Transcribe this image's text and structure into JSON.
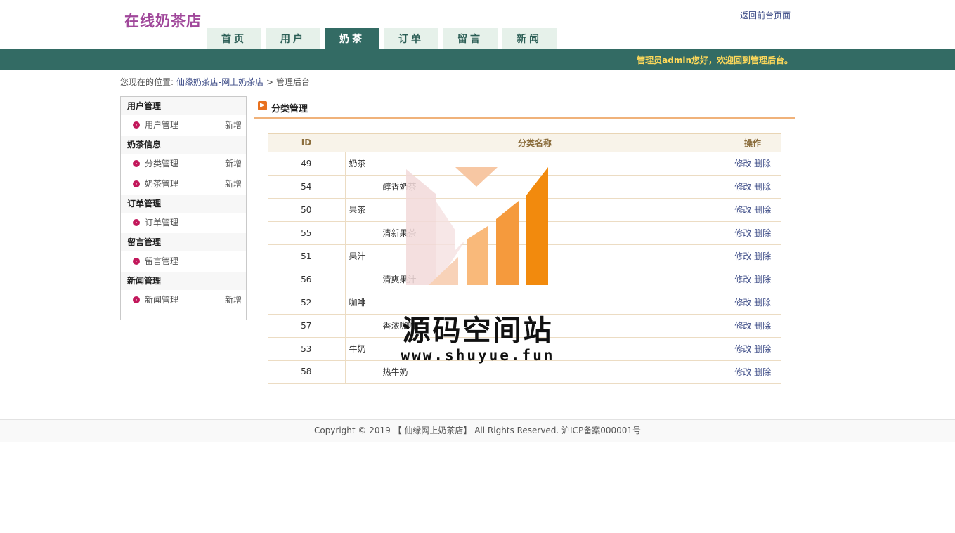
{
  "header": {
    "site_title": "在线奶茶店",
    "back_link": "返回前台页面"
  },
  "nav": {
    "tabs": [
      "首页",
      "用户",
      "奶茶",
      "订单",
      "留言",
      "新闻"
    ],
    "active": "奶茶"
  },
  "topbar": {
    "welcome": "管理员admin您好，欢迎回到管理后台。"
  },
  "breadcrumb": {
    "prefix": "您现在的位置:",
    "link": "仙缘奶茶店-网上奶茶店",
    "sep": ">",
    "current": "管理后台"
  },
  "sidebar": {
    "add_label": "新增",
    "groups": [
      {
        "title": "用户管理",
        "items": [
          {
            "label": "用户管理",
            "has_add": true
          }
        ]
      },
      {
        "title": "奶茶信息",
        "items": [
          {
            "label": "分类管理",
            "has_add": true
          },
          {
            "label": "奶茶管理",
            "has_add": true
          }
        ]
      },
      {
        "title": "订单管理",
        "items": [
          {
            "label": "订单管理",
            "has_add": false
          }
        ]
      },
      {
        "title": "留言管理",
        "items": [
          {
            "label": "留言管理",
            "has_add": false
          }
        ]
      },
      {
        "title": "新闻管理",
        "items": [
          {
            "label": "新闻管理",
            "has_add": true
          }
        ]
      }
    ]
  },
  "main": {
    "section_title": "分类管理",
    "table": {
      "headers": {
        "id": "ID",
        "name": "分类名称",
        "ops": "操作"
      },
      "edit_label": "修改",
      "delete_label": "删除",
      "rows": [
        {
          "id": "49",
          "name": "奶茶",
          "child": false
        },
        {
          "id": "54",
          "name": "醇香奶茶",
          "child": true
        },
        {
          "id": "50",
          "name": "果茶",
          "child": false
        },
        {
          "id": "55",
          "name": "清新果茶",
          "child": true
        },
        {
          "id": "51",
          "name": "果汁",
          "child": false
        },
        {
          "id": "56",
          "name": "清爽果汁",
          "child": true
        },
        {
          "id": "52",
          "name": "咖啡",
          "child": false
        },
        {
          "id": "57",
          "name": "香浓咖啡",
          "child": true
        },
        {
          "id": "53",
          "name": "牛奶",
          "child": false
        },
        {
          "id": "58",
          "name": "热牛奶",
          "child": true
        }
      ]
    }
  },
  "watermark": {
    "title": "源码空间站",
    "url": "www.shuyue.fun"
  },
  "footer": {
    "text": "Copyright © 2019 【 仙缘网上奶茶店】 All Rights Reserved. 沪ICP备案000001号"
  },
  "colors": {
    "brand": "#336b64",
    "title": "#a0479a",
    "welcome": "#ffd95a",
    "accent": "#e8711f"
  }
}
